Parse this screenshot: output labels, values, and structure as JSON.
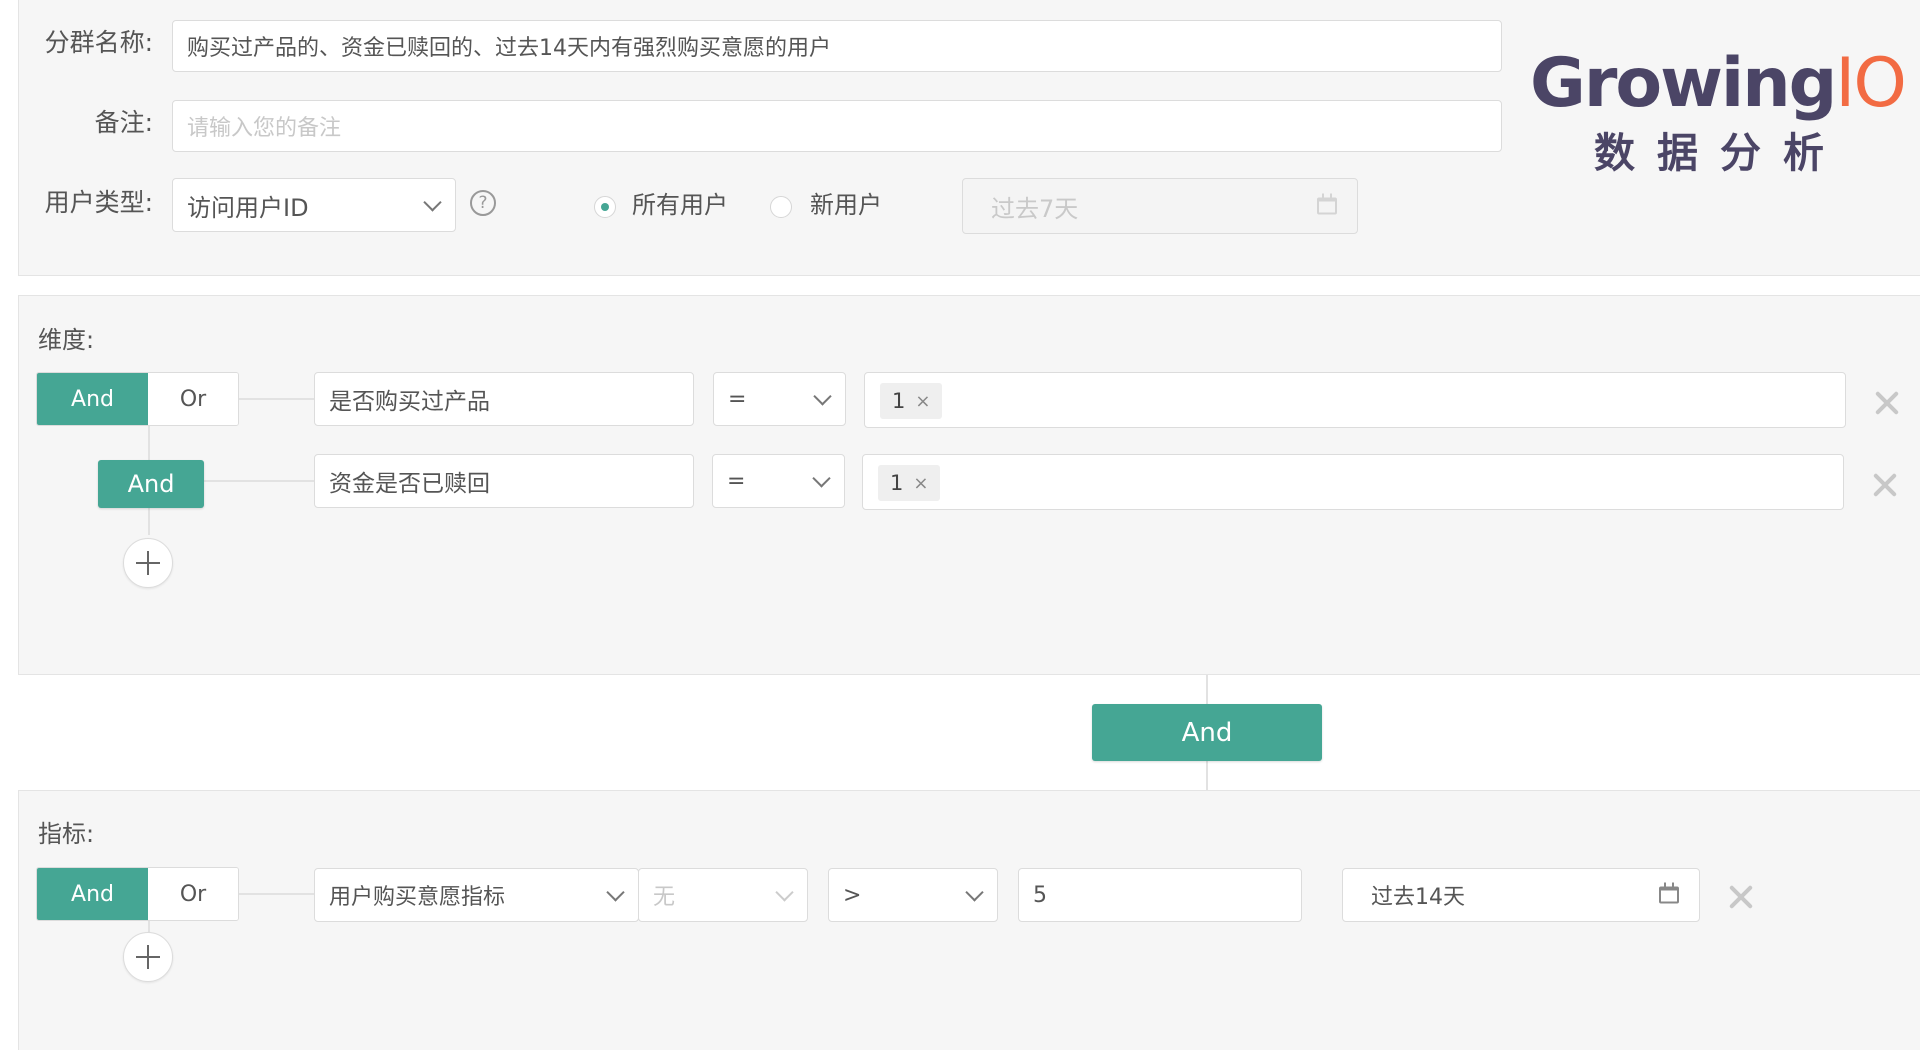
{
  "form": {
    "group_name_label": "分群名称:",
    "group_name_value": "购买过产品的、资金已赎回的、过去14天内有强烈购买意愿的用户",
    "note_label": "备注:",
    "note_placeholder": "请输入您的备注",
    "user_type_label": "用户类型:",
    "user_type_value": "访问用户ID",
    "help_glyph": "?",
    "radio_all": "所有用户",
    "radio_new": "新用户",
    "radio_selected": "所有用户",
    "period_value": "过去7天"
  },
  "dimension": {
    "title": "维度:",
    "and_label": "And",
    "or_label": "Or",
    "rows": [
      {
        "field": "是否购买过产品",
        "operator": "=",
        "tags": [
          "1"
        ]
      },
      {
        "field": "资金是否已赎回",
        "operator": "=",
        "tags": [
          "1"
        ]
      }
    ],
    "nested_and_label": "And",
    "tag_remove": "×"
  },
  "join": {
    "label": "And"
  },
  "metric": {
    "title": "指标:",
    "and_label": "And",
    "or_label": "Or",
    "metric_value": "用户购买意愿指标",
    "sub_value": "无",
    "operator": ">",
    "threshold": "5",
    "period_value": "过去14天"
  },
  "logo": {
    "brand_main": "Growing",
    "brand_accent": "IO",
    "subtitle": "数据分析"
  },
  "colors": {
    "accent": "#45a694",
    "logo_primary": "#4b4566",
    "logo_accent": "#f26b43"
  }
}
